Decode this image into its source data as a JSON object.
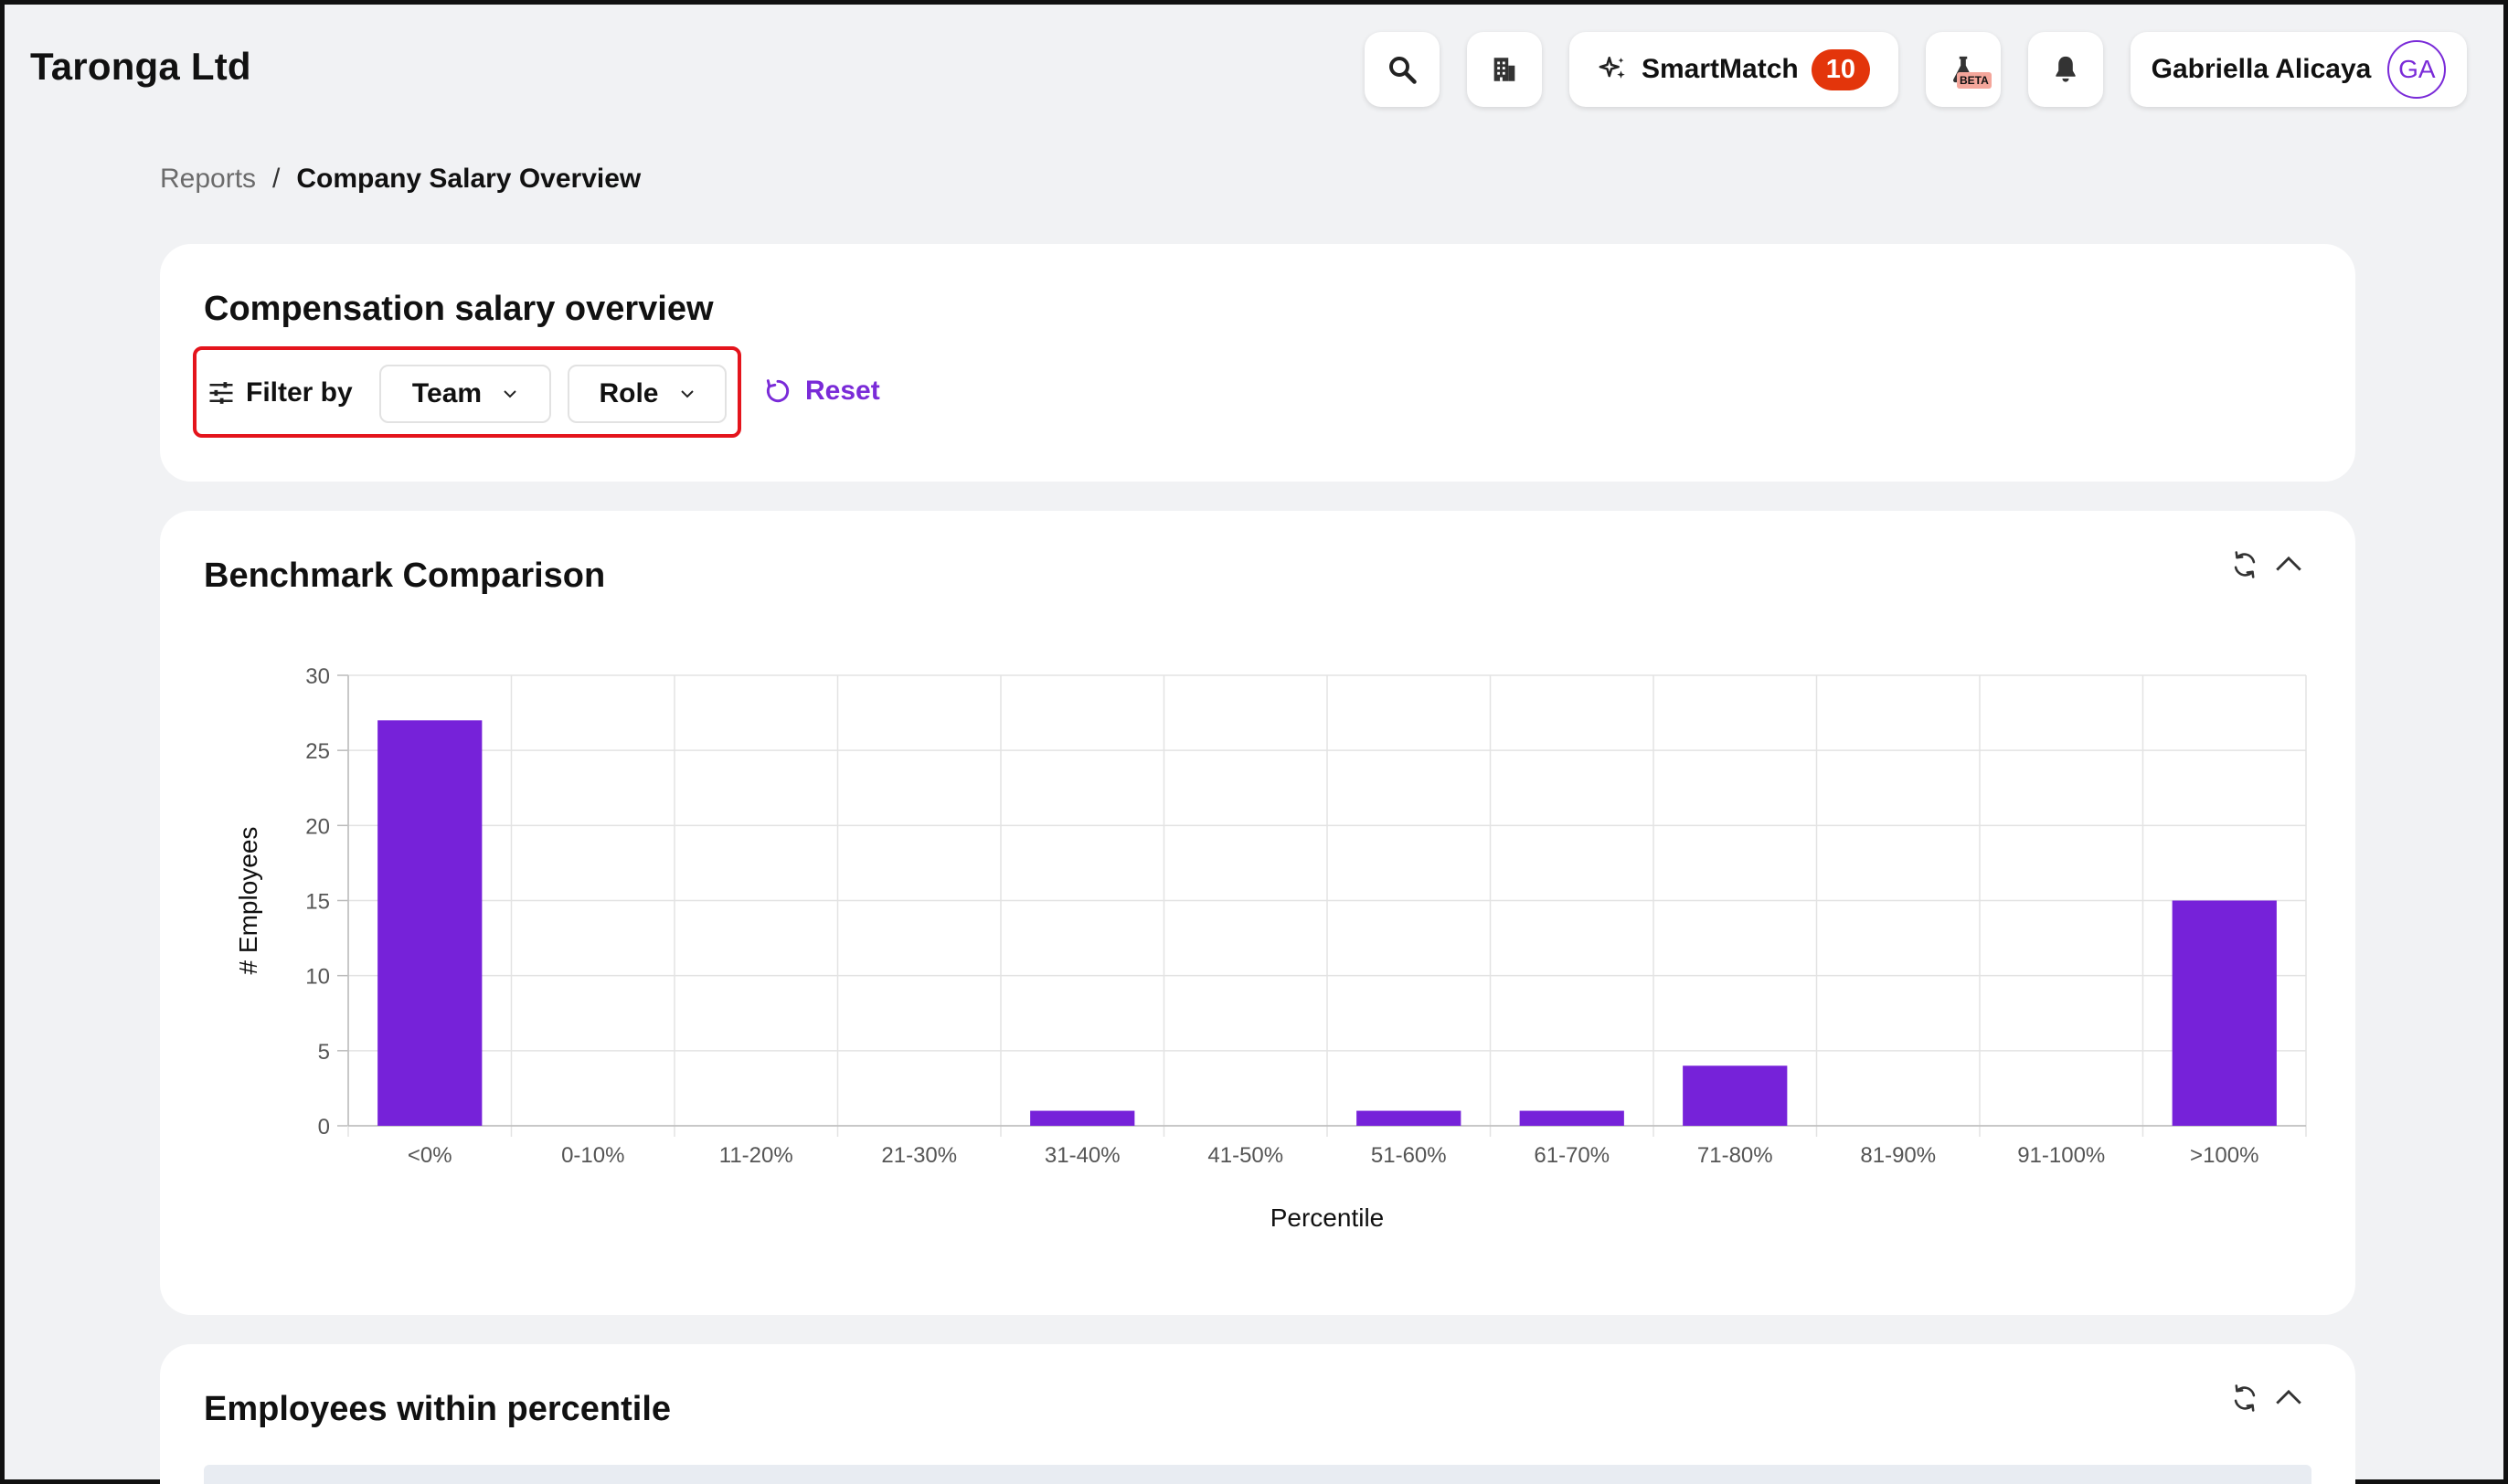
{
  "header": {
    "company": "Taronga Ltd",
    "search_icon": "search-icon",
    "building_icon": "building-icon",
    "smartmatch": {
      "label": "SmartMatch",
      "count": "10",
      "icon": "sparkles-icon"
    },
    "beta": {
      "icon": "flask-icon",
      "tag": "BETA"
    },
    "notifications_icon": "bell-icon",
    "user": {
      "name": "Gabriella Alicaya",
      "initials": "GA"
    }
  },
  "breadcrumb": {
    "parent": "Reports",
    "separator": "/",
    "current": "Company Salary Overview"
  },
  "filters": {
    "title": "Compensation salary overview",
    "label": "Filter by",
    "team_label": "Team",
    "role_label": "Role",
    "reset_label": "Reset"
  },
  "benchmark": {
    "title": "Benchmark Comparison",
    "refresh_icon": "refresh-icon",
    "collapse_icon": "chevron-up-icon"
  },
  "employees_section": {
    "title": "Employees within percentile",
    "refresh_icon": "refresh-icon",
    "collapse_icon": "chevron-up-icon"
  },
  "colors": {
    "accent": "#7a2bd8",
    "bar": "#7622d9",
    "badge": "#e3350b",
    "highlight": "#e4141c"
  },
  "chart_data": {
    "type": "bar",
    "categories": [
      "<0%",
      "0-10%",
      "11-20%",
      "21-30%",
      "31-40%",
      "41-50%",
      "51-60%",
      "61-70%",
      "71-80%",
      "81-90%",
      "91-100%",
      ">100%"
    ],
    "values": [
      27,
      0,
      0,
      0,
      1,
      0,
      1,
      1,
      4,
      0,
      0,
      15
    ],
    "xlabel": "Percentile",
    "ylabel": "# Employees",
    "ylim": [
      0,
      30
    ],
    "yticks": [
      0,
      5,
      10,
      15,
      20,
      25,
      30
    ],
    "grid": true,
    "legend": "none"
  }
}
